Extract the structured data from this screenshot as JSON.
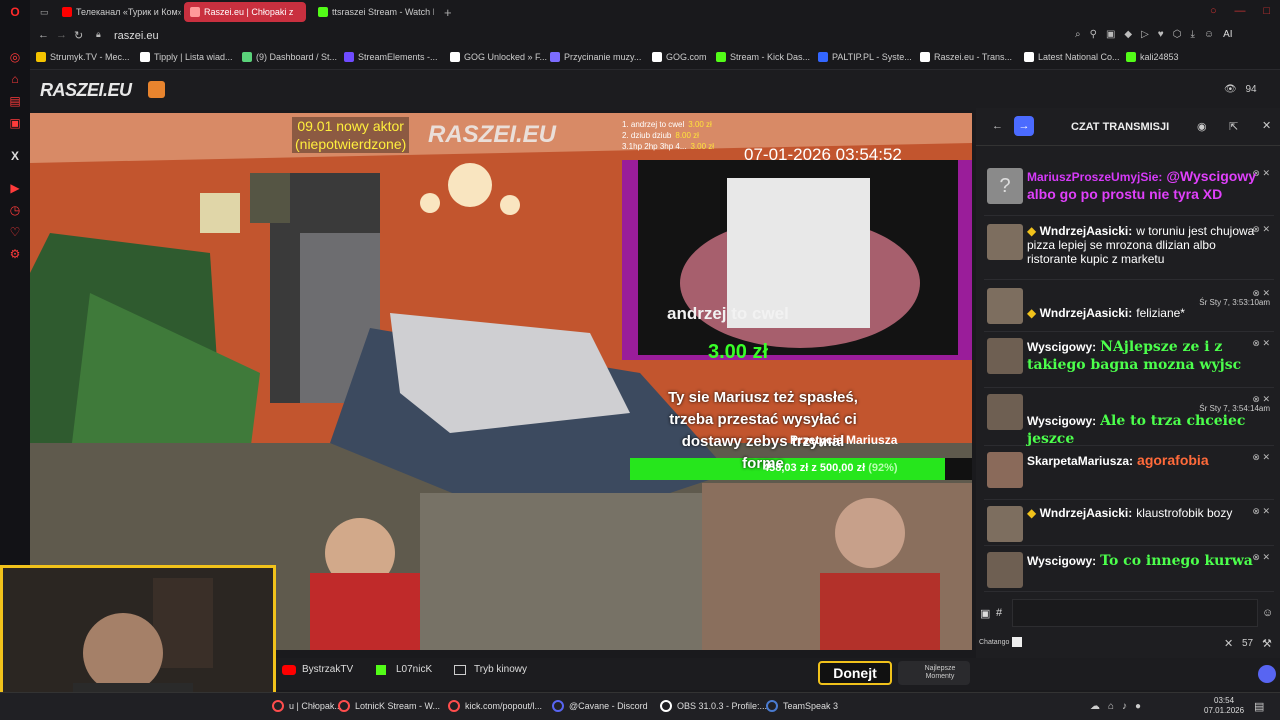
{
  "browser": {
    "tabs": [
      {
        "label": "Телеканал «Турик и Ком»",
        "color": "#ff0000"
      },
      {
        "label": "Raszei.eu | Chłopaki z",
        "color": "#ff4d4d"
      },
      {
        "label": "ttsraszei Stream - Watch L",
        "color": "#53fc18"
      }
    ],
    "address": "raszei.eu",
    "bookmarks": [
      {
        "label": "Strumyk.TV - Mec...",
        "color": "#f5c400"
      },
      {
        "label": "Tipply | Lista wiad...",
        "color": "#ffffff"
      },
      {
        "label": "(9) Dashboard / St...",
        "color": "#5ad37a"
      },
      {
        "label": "StreamElements -...",
        "color": "#6f4bff"
      },
      {
        "label": "GOG Unlocked » F...",
        "color": "#ffffff"
      },
      {
        "label": "Przycinanie muzy...",
        "color": "#7c6cff"
      },
      {
        "label": "GOG.com",
        "color": "#ffffff"
      },
      {
        "label": "Stream - Kick Das...",
        "color": "#53fc18"
      },
      {
        "label": "PALTIP.PL - Syste...",
        "color": "#3366ff"
      },
      {
        "label": "Raszei.eu - Trans...",
        "color": "#ffffff"
      },
      {
        "label": "Latest National Co...",
        "color": "#ffffff"
      },
      {
        "label": "kali24853",
        "color": "#53fc18"
      }
    ],
    "ai_label": "AI"
  },
  "site": {
    "logo": "RASZEI.EU",
    "viewers": "94"
  },
  "overlay": {
    "new_actor_line1": "09.01 nowy aktor",
    "new_actor_line2": "(niepotwierdzone)",
    "watermark": "RASZEI.EU",
    "donation_list": [
      {
        "text": "1. andrzej to cwel",
        "amount": "3.00 zł"
      },
      {
        "text": "2. dziub dziub",
        "amount": "8.00 zł"
      },
      {
        "text": "3.1hp 2hp 3hp 4...",
        "amount": "3.00 zł"
      }
    ],
    "timestamp": "07-01-2026 03:54:52",
    "alert_text": "andrzej to cwel",
    "alert_amount": "3.00 zł",
    "tts_line1": "Ty sie Mariusz też spasłeś,",
    "tts_line2": "trzeba przestać wysyłać ci",
    "tts_line3": "dostawy zebys trzymal",
    "tts_line4": "forme",
    "goal_title": "Przetycie Mariusza",
    "goal_text": "458,03 zł z 500,00 zł",
    "goal_percent_label": "(92%)",
    "goal_fraction": 0.92
  },
  "chat": {
    "title": "CZAT TRANSMISJI",
    "messages": [
      {
        "user": "MariuszProszeUmyjSie:",
        "text": "@Wyscigowy albo go po prostu nie tyra XD",
        "user_color": "#d63af9",
        "text_color": "#e040fb",
        "time": "",
        "badge": false,
        "avatar": "?"
      },
      {
        "user": "WndrzejAasicki:",
        "text": "w toruniu jest chujowa pizza lepiej se mrozona dlizian albo ristorante kupic z marketu",
        "user_color": "#ffffff",
        "text_color": "#ffffff",
        "time": "",
        "badge": true,
        "avatar": ""
      },
      {
        "user": "WndrzejAasicki:",
        "text": "feliziane*",
        "user_color": "#ffffff",
        "text_color": "#ffffff",
        "time": "Śr Sty 7, 3:53:10am",
        "badge": true,
        "avatar": ""
      },
      {
        "user": "Wyscigowy:",
        "text": "NAjlepsze ze i z takiego bagna mozna wyjsc",
        "user_color": "#ffffff",
        "text_color": "#4cff4c",
        "time": "",
        "badge": false,
        "avatar": ""
      },
      {
        "user": "Wyscigowy:",
        "text": "Ale to trza chceiec jeszce",
        "user_color": "#ffffff",
        "text_color": "#4cff4c",
        "time": "Śr Sty 7, 3:54:14am",
        "badge": false,
        "avatar": ""
      },
      {
        "user": "SkarpetaMariusza:",
        "text": "agorafobia",
        "user_color": "#ffffff",
        "text_color": "#ff6a3a",
        "time": "",
        "badge": false,
        "avatar": ""
      },
      {
        "user": "WndrzejAasicki:",
        "text": "klaustrofobik bozy",
        "user_color": "#ffffff",
        "text_color": "#ffffff",
        "time": "",
        "badge": true,
        "avatar": ""
      },
      {
        "user": "Wyscigowy:",
        "text": "To co innego kurwa",
        "user_color": "#ffffff",
        "text_color": "#4cff4c",
        "time": "",
        "badge": false,
        "avatar": ""
      }
    ],
    "input_hash": "#",
    "chatango_label": "Chatango",
    "volume": "57"
  },
  "bottom": {
    "btn1": "BystrzakTV",
    "btn2": "L07nicK",
    "btn3": "Tryb kinowy",
    "donejt": "Donejt",
    "najlepsze": "Najlepsze Momenty"
  },
  "taskbar": {
    "items": [
      {
        "label": "u | Chłopak...",
        "color": "#ff4d4d"
      },
      {
        "label": "LotnicK Stream - W...",
        "color": "#ff4d4d"
      },
      {
        "label": "kick.com/popout/l...",
        "color": "#ff4d4d"
      },
      {
        "label": "@Cavane - Discord",
        "color": "#5865f2"
      },
      {
        "label": "OBS 31.0.3 - Profile:...",
        "color": "#ffffff"
      },
      {
        "label": "TeamSpeak 3",
        "color": "#4a7bd0"
      }
    ],
    "time": "03:54",
    "date": "07.01.2026"
  }
}
